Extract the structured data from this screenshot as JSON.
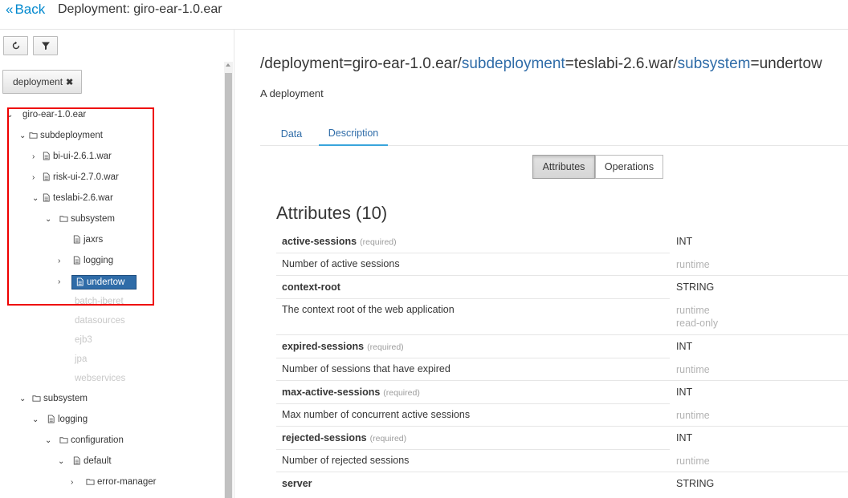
{
  "header": {
    "back_label": "Back",
    "title": "Deployment: giro-ear-1.0.ear"
  },
  "toolbar": {
    "refresh_icon": "refresh-icon",
    "filter_icon": "filter-icon"
  },
  "filter": {
    "chip_label": "deployment",
    "chip_remove": "✖"
  },
  "tree": {
    "root": "giro-ear-1.0.ear",
    "subdeployment": "subdeployment",
    "bi_ui": "bi-ui-2.6.1.war",
    "risk_ui": "risk-ui-2.7.0.war",
    "teslabi": "teslabi-2.6.war",
    "subsystem1": "subsystem",
    "jaxrs": "jaxrs",
    "logging1": "logging",
    "undertow": "undertow",
    "batch": "batch-jberet",
    "datasources": "datasources",
    "ejb3": "ejb3",
    "jpa": "jpa",
    "webservices": "webservices",
    "subsystem2": "subsystem",
    "logging2": "logging",
    "configuration": "configuration",
    "default": "default",
    "error_manager": "error-manager"
  },
  "address": {
    "p1": "/deployment=giro-ear-1.0.ear/",
    "p2": "subdeployment",
    "p3": "=teslabi-2.6.war/",
    "p4": "subsystem",
    "p5": "=undertow"
  },
  "description": "A deployment",
  "tabs": {
    "data": "Data",
    "description": "Description"
  },
  "buttons": {
    "attributes": "Attributes",
    "operations": "Operations"
  },
  "attributes_heading": "Attributes (10)",
  "attributes": [
    {
      "name": "active-sessions",
      "required": "(required)",
      "type": "INT",
      "desc": "Number of active sessions",
      "meta1": "runtime",
      "meta2": ""
    },
    {
      "name": "context-root",
      "required": "",
      "type": "STRING",
      "desc": "The context root of the web application",
      "meta1": "runtime",
      "meta2": "read-only"
    },
    {
      "name": "expired-sessions",
      "required": "(required)",
      "type": "INT",
      "desc": "Number of sessions that have expired",
      "meta1": "runtime",
      "meta2": ""
    },
    {
      "name": "max-active-sessions",
      "required": "(required)",
      "type": "INT",
      "desc": "Max number of concurrent active sessions",
      "meta1": "runtime",
      "meta2": ""
    },
    {
      "name": "rejected-sessions",
      "required": "(required)",
      "type": "INT",
      "desc": "Number of rejected sessions",
      "meta1": "runtime",
      "meta2": ""
    },
    {
      "name": "server",
      "required": "",
      "type": "STRING",
      "desc": "",
      "meta1": "",
      "meta2": ""
    }
  ]
}
